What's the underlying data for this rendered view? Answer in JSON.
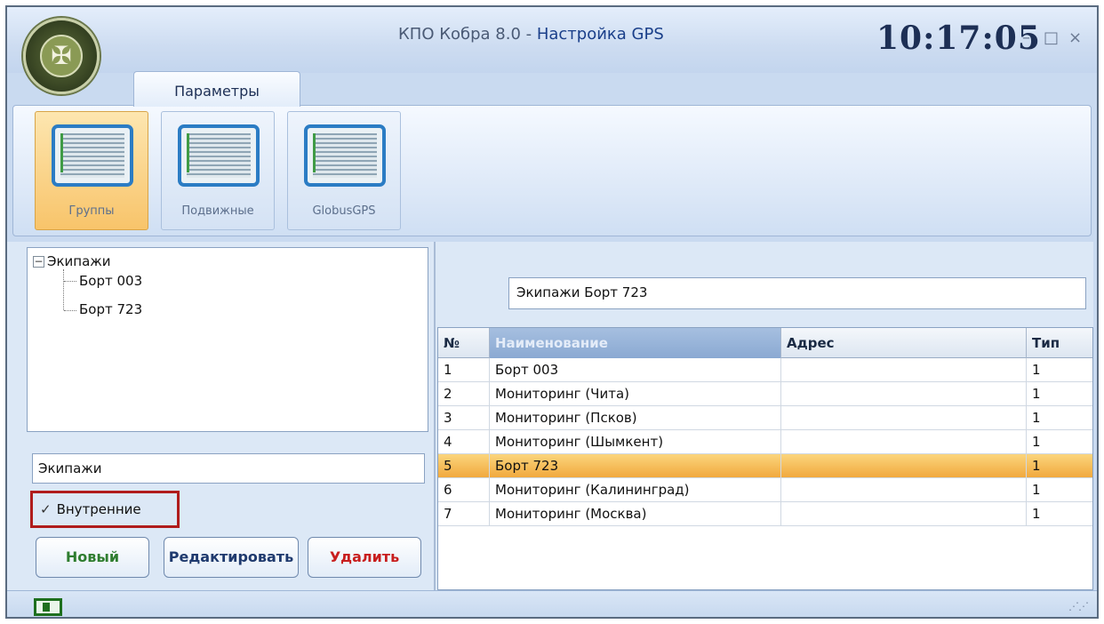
{
  "window": {
    "title_prefix": "КПО Кобра 8.0 - ",
    "title_page": "Настройка GPS",
    "clock": "10:17:05",
    "controls": {
      "minimize": "–",
      "maximize": "□",
      "close": "×"
    }
  },
  "tabs": [
    {
      "label": "Параметры"
    }
  ],
  "ribbon": {
    "buttons": [
      {
        "label": "Группы",
        "icon": "grid-screen-icon",
        "active": true
      },
      {
        "label": "Подвижные",
        "icon": "grid-screen-icon",
        "active": false
      },
      {
        "label": "GlobusGPS",
        "icon": "grid-screen-icon",
        "active": false
      }
    ]
  },
  "tree": {
    "root": {
      "label": "Экипажи",
      "toggle": "−"
    },
    "children": [
      {
        "label": "Борт 003"
      },
      {
        "label": "Борт 723"
      }
    ]
  },
  "left": {
    "name_value": "Экипажи",
    "checkbox": {
      "label": "Внутренние",
      "checked": true,
      "mark": "✓"
    },
    "buttons": {
      "new": "Новый",
      "edit": "Редактировать",
      "delete": "Удалить"
    }
  },
  "right": {
    "group_field": "Экипажи Борт 723",
    "grid": {
      "columns": [
        "№",
        "Наименование",
        "Адрес",
        "Тип"
      ],
      "rows": [
        {
          "num": "1",
          "name": "Борт 003",
          "address": "",
          "type": "1"
        },
        {
          "num": "2",
          "name": "Мониторинг (Чита)",
          "address": "",
          "type": "1"
        },
        {
          "num": "3",
          "name": "Мониторинг (Псков)",
          "address": "",
          "type": "1"
        },
        {
          "num": "4",
          "name": "Мониторинг (Шымкент)",
          "address": "",
          "type": "1"
        },
        {
          "num": "5",
          "name": "Борт 723",
          "address": "",
          "type": "1"
        },
        {
          "num": "6",
          "name": "Мониторинг (Калининград)",
          "address": "",
          "type": "1"
        },
        {
          "num": "7",
          "name": "Мониторинг (Москва)",
          "address": "",
          "type": "1"
        }
      ],
      "selected_row": 5
    }
  },
  "colors": {
    "selection": "#f1a93d",
    "new_button": "#2f7d2f",
    "edit_button": "#1f3a6e",
    "delete_button": "#c81e1e",
    "highlight_border": "#b01c1c"
  }
}
